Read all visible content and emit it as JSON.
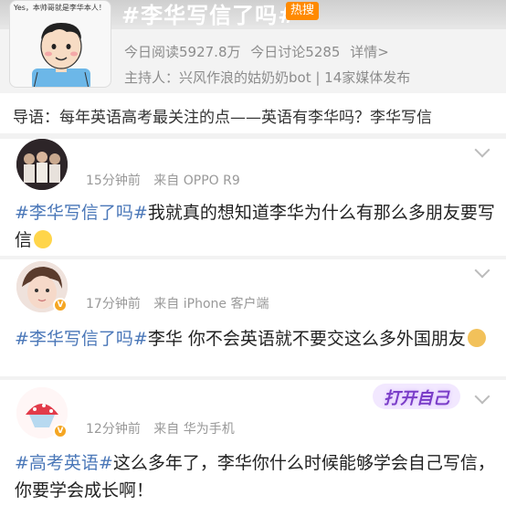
{
  "header": {
    "cover_caption": "Yes，本帅哥就是李华本人！",
    "topic_title": "#李华写信了吗#",
    "hot_badge": "热搜",
    "stats": {
      "reads": "今日阅读5927.8万",
      "discussions": "今日讨论5285",
      "detail": "详情>"
    },
    "host": "主持人：兴风作浪的姑奶奶bot | 14家媒体发布"
  },
  "guide": "导语：每年英语高考最关注的点——英语有李华吗？李华写信",
  "posts": [
    {
      "time": "15分钟前",
      "source_prefix": "来自",
      "device": "OPPO R9",
      "hashtag": "#李华写信了吗#",
      "text": "我就真的想知道李华为什么有那么多朋友要写信",
      "emoji": "crying-face-emoji"
    },
    {
      "time": "17分钟前",
      "source_prefix": "来自",
      "device": "iPhone 客户端",
      "hashtag": "#李华写信了吗#",
      "text": "李华 你不会英语就不要交这么多外国朋友",
      "emoji": "dog-face-emoji"
    },
    {
      "time": "12分钟前",
      "source_prefix": "来自",
      "device": "华为手机",
      "hashtag": "#高考英语#",
      "text": "这么多年了，李华你什么时候能够学会自己写信，你要学会成长啊！",
      "sticker": "打开自己"
    }
  ],
  "colors": {
    "hashtag": "#4a77b8",
    "hot_badge": "#ff8a00",
    "meta": "#999999"
  }
}
